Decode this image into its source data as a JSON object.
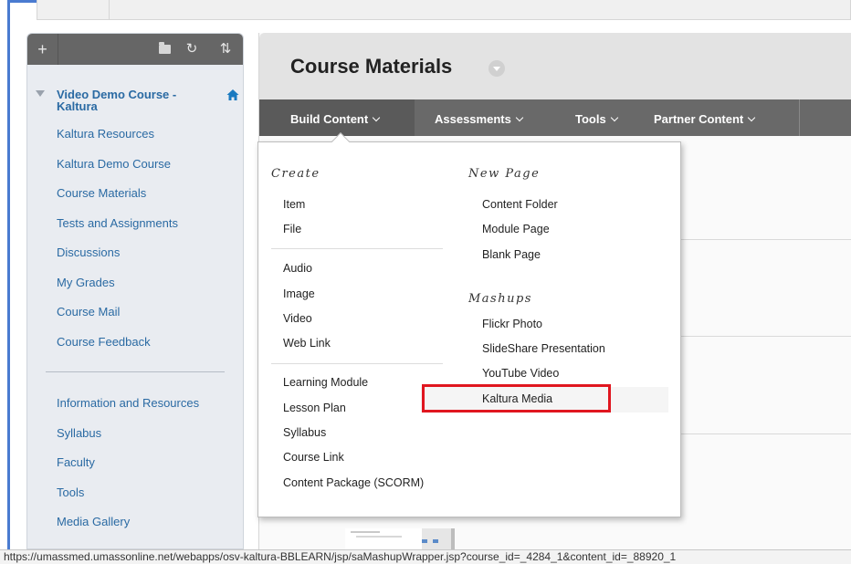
{
  "sidebar": {
    "course_title": "Video Demo Course - Kaltura",
    "items": [
      "Kaltura Resources",
      "Kaltura Demo Course",
      "Course Materials",
      "Tests and Assignments",
      "Discussions",
      "My Grades",
      "Course Mail",
      "Course Feedback"
    ],
    "items_secondary": [
      "Information and Resources",
      "Syllabus",
      "Faculty",
      "Tools",
      "Media Gallery"
    ],
    "toolbar": {
      "add_icon": "plus-icon",
      "folder_icon": "folder-icon",
      "refresh_icon": "refresh-icon",
      "sort_icon": "sort-icon"
    },
    "colors": {
      "link": "#2a6aa3",
      "toolbar": "#666666",
      "background": "#e9ecf1",
      "home": "#1a7ac0"
    }
  },
  "page": {
    "title": "Course Materials"
  },
  "action_bar": {
    "build_content": "Build Content",
    "assessments": "Assessments",
    "tools": "Tools",
    "partner_content": "Partner Content"
  },
  "dropdown": {
    "create_heading": "Create",
    "create_items": [
      "Item",
      "File"
    ],
    "media_items": [
      "Audio",
      "Image",
      "Video",
      "Web Link"
    ],
    "module_items": [
      "Learning Module",
      "Lesson Plan",
      "Syllabus",
      "Course Link",
      "Content Package (SCORM)"
    ],
    "new_page_heading": "New Page",
    "new_page_items": [
      "Content Folder",
      "Module Page",
      "Blank Page"
    ],
    "mashups_heading": "Mashups",
    "mashup_items": [
      "Flickr Photo",
      "SlideShare Presentation",
      "YouTube Video"
    ],
    "highlighted_item": "Kaltura Media",
    "highlight_color": "#e0161f"
  },
  "status_bar": {
    "url": "https://umassmed.umassonline.net/webapps/osv-kaltura-BBLEARN/jsp/saMashupWrapper.jsp?course_id=_4284_1&content_id=_88920_1"
  }
}
